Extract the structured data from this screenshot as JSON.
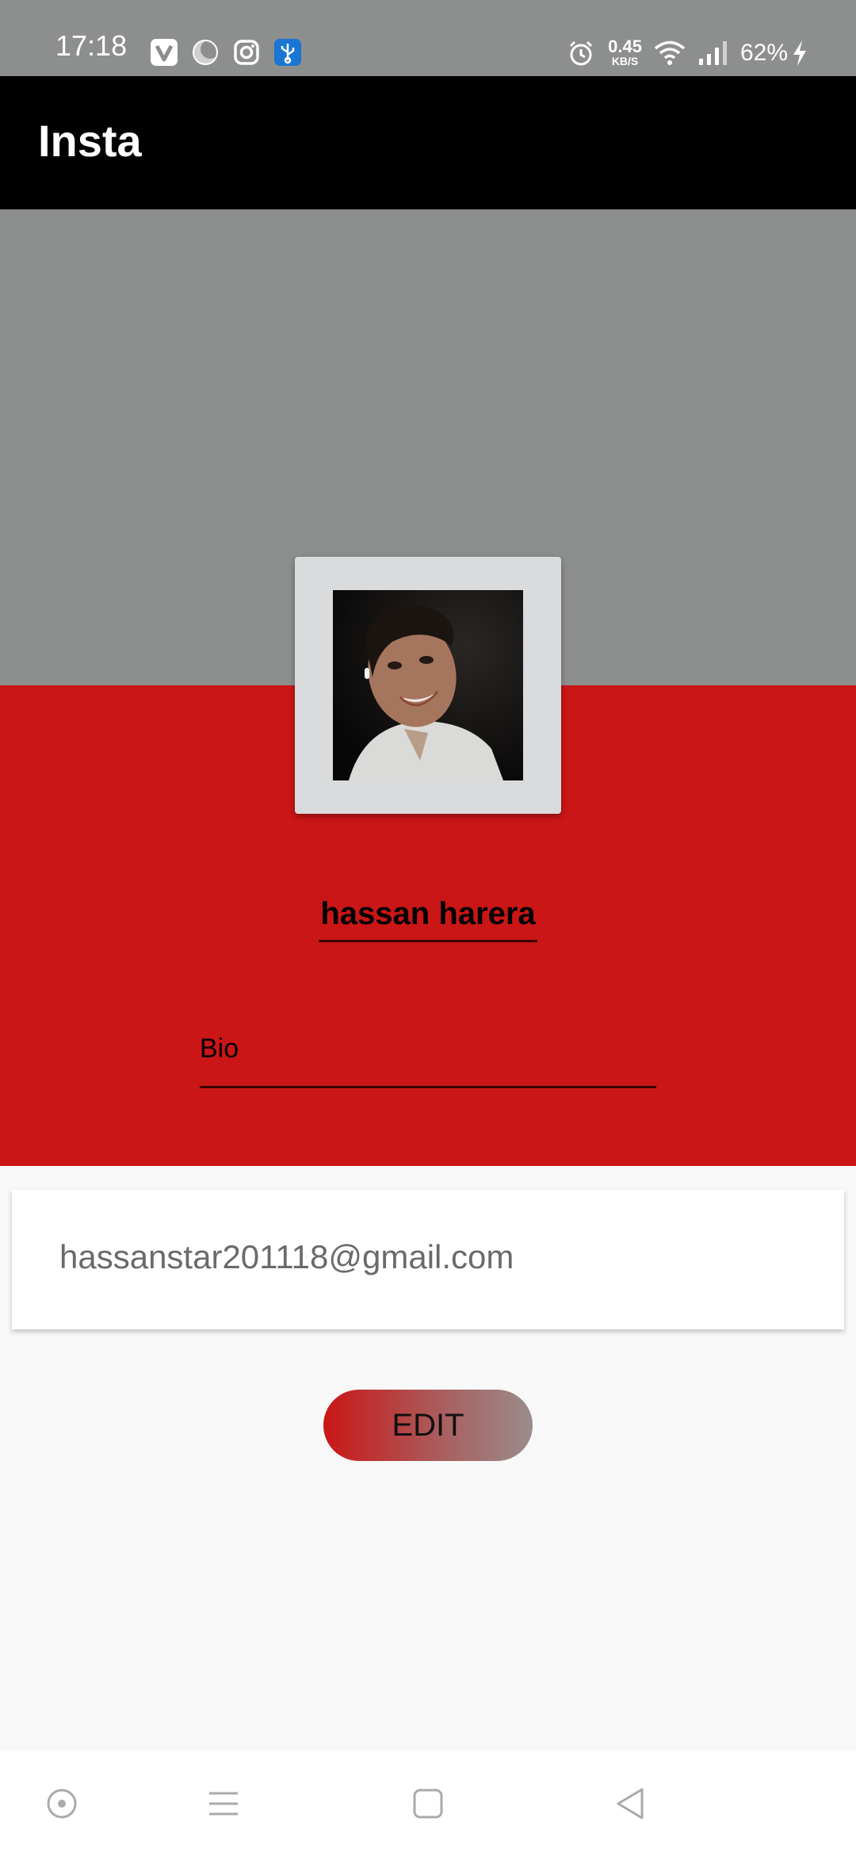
{
  "status_bar": {
    "time": "17:18",
    "net_speed_value": "0.45",
    "net_speed_unit": "KB/S",
    "battery": "62%",
    "notification_icons": [
      "v-app-icon",
      "moon-icon",
      "instagram-icon",
      "usb-icon"
    ],
    "system_icons": [
      "alarm-icon",
      "wifi-icon",
      "signal-icon",
      "charging-icon"
    ]
  },
  "app_bar": {
    "title": "Insta"
  },
  "profile": {
    "name": "hassan harera",
    "bio_placeholder": "Bio",
    "email": "hassanstar201118@gmail.com"
  },
  "actions": {
    "edit_label": "EDIT"
  },
  "nav_bar": {
    "buttons": [
      "assistant-icon",
      "menu-icon",
      "home-icon",
      "back-icon"
    ]
  },
  "colors": {
    "header_grey": "#8d8f8e",
    "app_bar": "#000000",
    "accent_red": "#ca1616",
    "card_white": "#ffffff",
    "background": "#f8f8f8"
  }
}
